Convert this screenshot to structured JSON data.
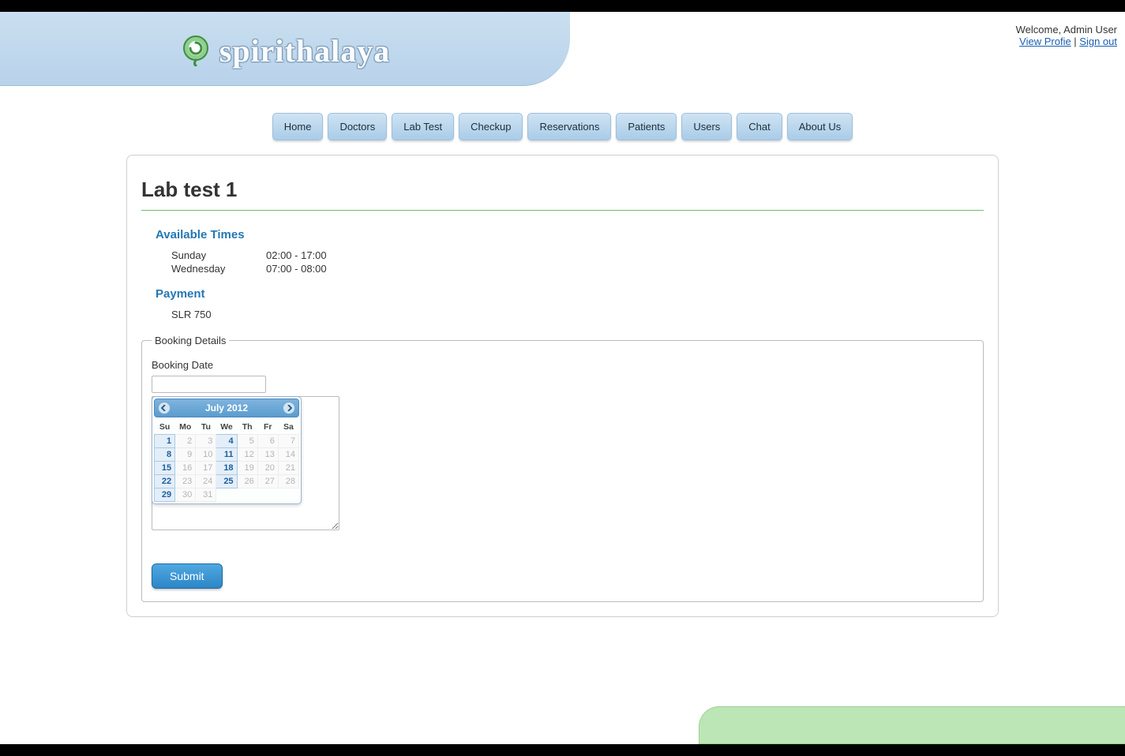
{
  "header": {
    "brand": "spirithalaya",
    "welcome": "Welcome, Admin User",
    "view_profile": "View Profie",
    "signout": "Sign out",
    "sep": " | "
  },
  "nav": [
    "Home",
    "Doctors",
    "Lab Test",
    "Checkup",
    "Reservations",
    "Patients",
    "Users",
    "Chat",
    "About Us"
  ],
  "page": {
    "title": "Lab test 1",
    "avail_heading": "Available Times",
    "times": [
      {
        "day": "Sunday",
        "range": "02:00 - 17:00"
      },
      {
        "day": "Wednesday",
        "range": "07:00 - 08:00"
      }
    ],
    "payment_heading": "Payment",
    "payment_value": "SLR 750"
  },
  "booking": {
    "legend": "Booking Details",
    "date_label": "Booking Date",
    "date_value": "",
    "submit": "Submit"
  },
  "calendar": {
    "title": "July 2012",
    "dow": [
      "Su",
      "Mo",
      "Tu",
      "We",
      "Th",
      "Fr",
      "Sa"
    ],
    "weeks": [
      [
        {
          "n": "1",
          "a": true
        },
        {
          "n": "2",
          "a": false
        },
        {
          "n": "3",
          "a": false
        },
        {
          "n": "4",
          "a": true
        },
        {
          "n": "5",
          "a": false
        },
        {
          "n": "6",
          "a": false
        },
        {
          "n": "7",
          "a": false
        }
      ],
      [
        {
          "n": "8",
          "a": true
        },
        {
          "n": "9",
          "a": false
        },
        {
          "n": "10",
          "a": false
        },
        {
          "n": "11",
          "a": true
        },
        {
          "n": "12",
          "a": false
        },
        {
          "n": "13",
          "a": false
        },
        {
          "n": "14",
          "a": false
        }
      ],
      [
        {
          "n": "15",
          "a": true
        },
        {
          "n": "16",
          "a": false
        },
        {
          "n": "17",
          "a": false
        },
        {
          "n": "18",
          "a": true
        },
        {
          "n": "19",
          "a": false
        },
        {
          "n": "20",
          "a": false
        },
        {
          "n": "21",
          "a": false
        }
      ],
      [
        {
          "n": "22",
          "a": true
        },
        {
          "n": "23",
          "a": false
        },
        {
          "n": "24",
          "a": false
        },
        {
          "n": "25",
          "a": true
        },
        {
          "n": "26",
          "a": false
        },
        {
          "n": "27",
          "a": false
        },
        {
          "n": "28",
          "a": false
        }
      ],
      [
        {
          "n": "29",
          "a": true
        },
        {
          "n": "30",
          "a": false
        },
        {
          "n": "31",
          "a": false
        },
        {
          "n": "",
          "a": false
        },
        {
          "n": "",
          "a": false
        },
        {
          "n": "",
          "a": false
        },
        {
          "n": "",
          "a": false
        }
      ]
    ]
  }
}
